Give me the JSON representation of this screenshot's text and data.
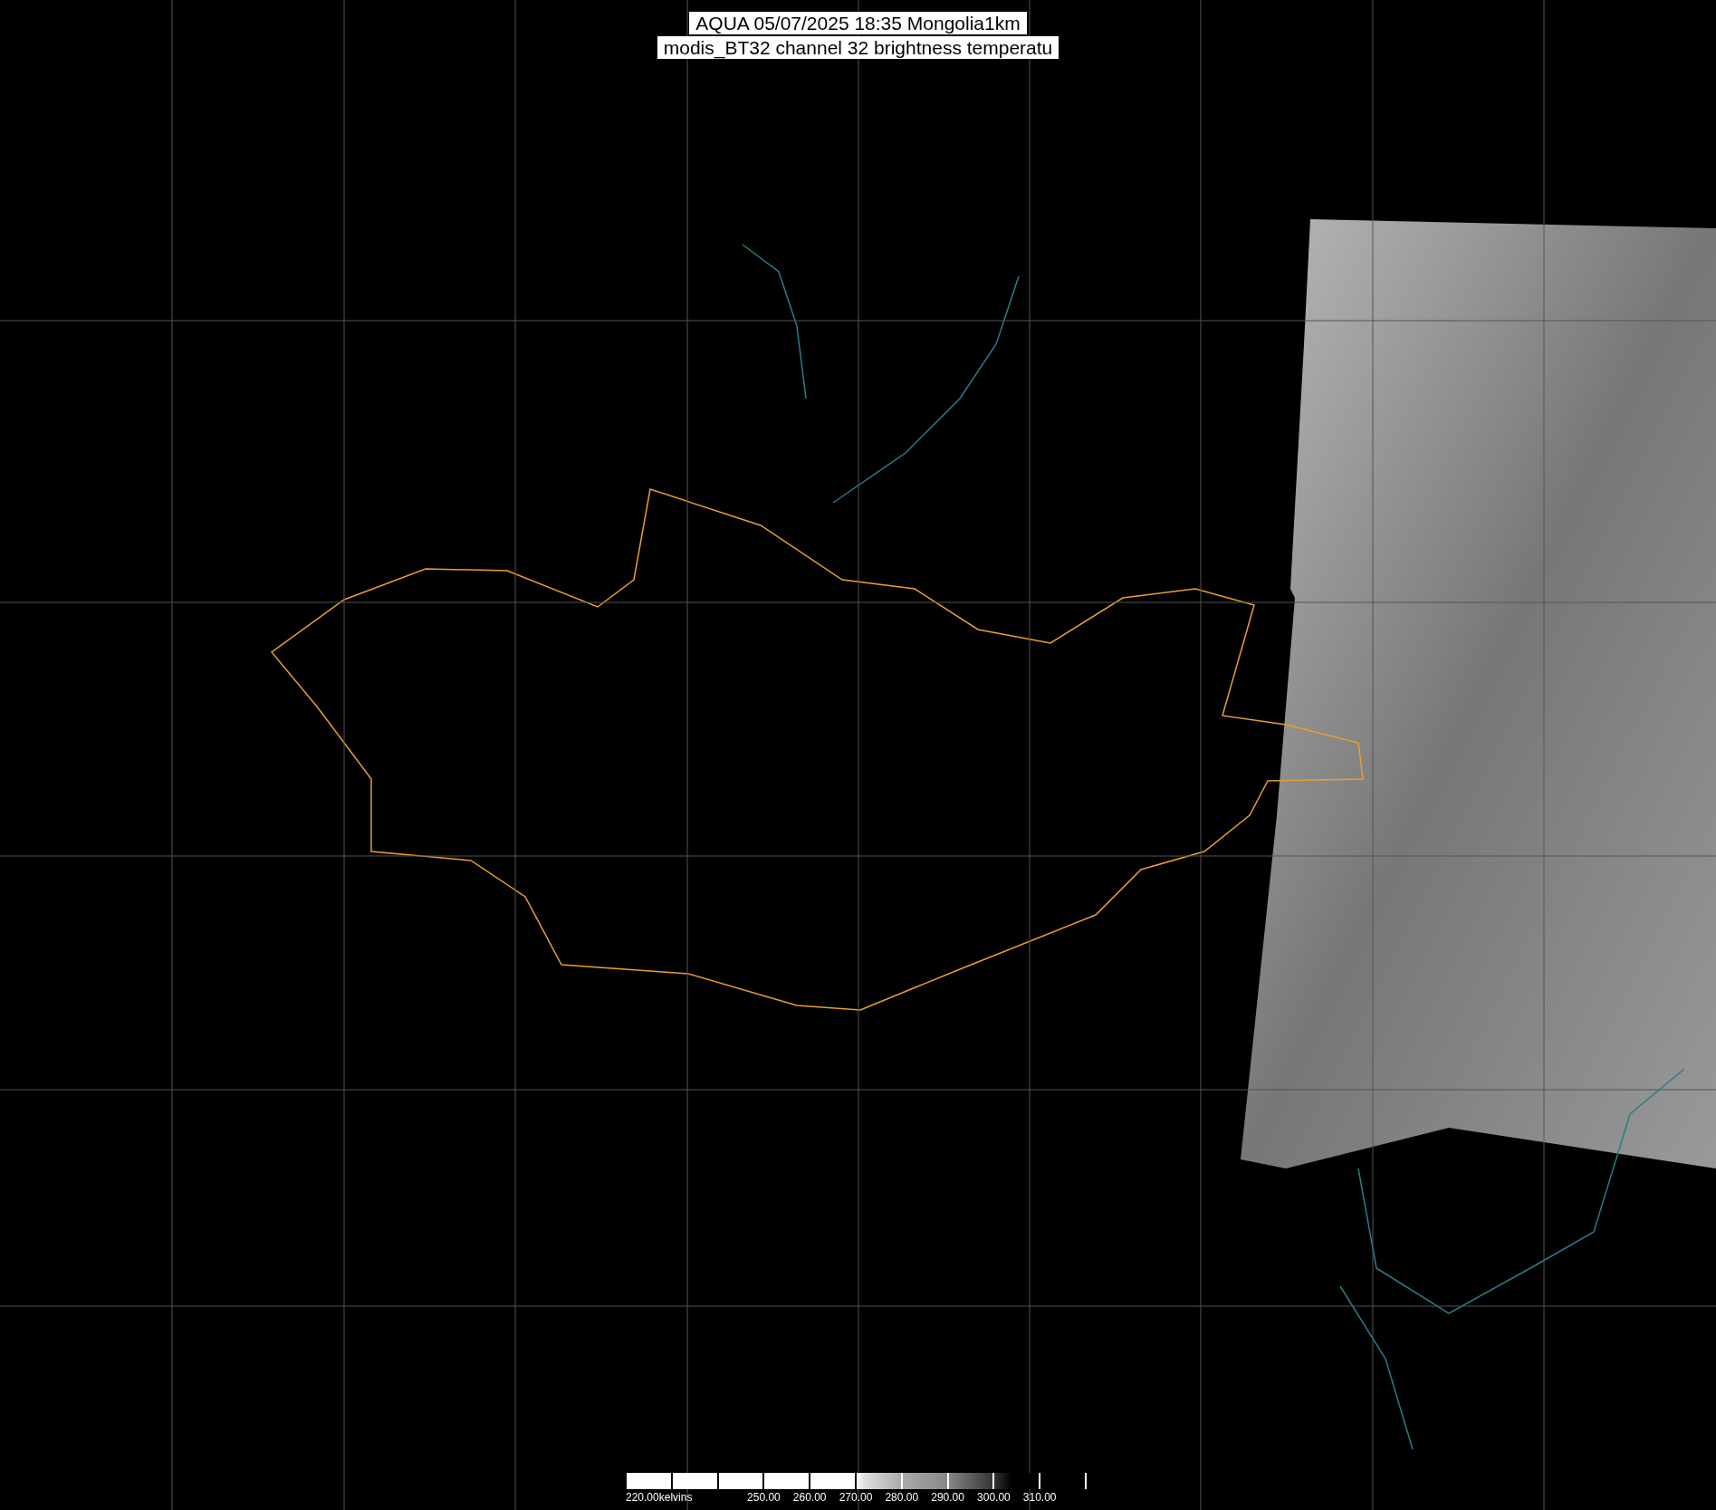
{
  "title": {
    "lines": [
      "AQUA 05/07/2025 18:35 Mongolia1km",
      "modis_BT32 channel 32 brightness temperatu"
    ]
  },
  "colorbar": {
    "labels": [
      "220.00kelvins",
      "250.00",
      "260.00",
      "270.00",
      "280.00",
      "290.00",
      "300.00",
      "310.00"
    ]
  }
}
